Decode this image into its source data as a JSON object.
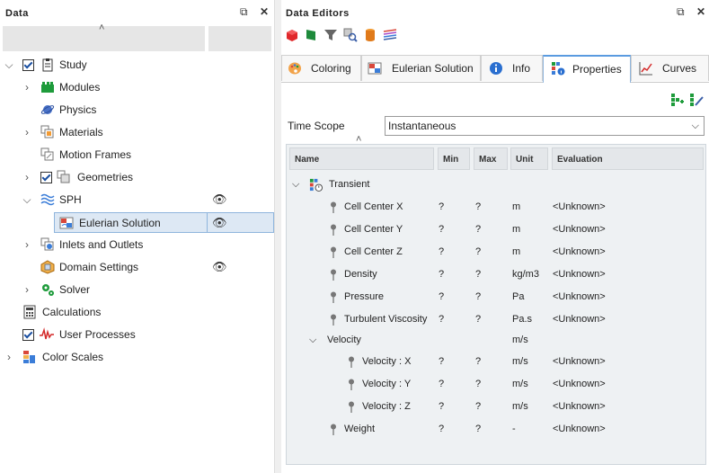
{
  "left_panel": {
    "title": "Data",
    "tree": [
      {
        "label": "Study"
      },
      {
        "label": "Modules"
      },
      {
        "label": "Physics"
      },
      {
        "label": "Materials"
      },
      {
        "label": "Motion Frames"
      },
      {
        "label": "Geometries"
      },
      {
        "label": "SPH"
      },
      {
        "label": "Eulerian Solution"
      },
      {
        "label": "Inlets and Outlets"
      },
      {
        "label": "Domain Settings"
      },
      {
        "label": "Solver"
      },
      {
        "label": "Calculations"
      },
      {
        "label": "User Processes"
      },
      {
        "label": "Color Scales"
      }
    ]
  },
  "right_panel": {
    "title": "Data Editors",
    "tabs": [
      {
        "label": "Coloring"
      },
      {
        "label": "Eulerian Solution"
      },
      {
        "label": "Info"
      },
      {
        "label": "Properties"
      },
      {
        "label": "Curves"
      }
    ],
    "time_scope": {
      "label": "Time Scope",
      "value": "Instantaneous"
    },
    "columns": [
      "Name",
      "Min",
      "Max",
      "Unit",
      "Evaluation"
    ],
    "group": "Transient",
    "rows": [
      {
        "name": "Cell Center X",
        "min": "?",
        "max": "?",
        "unit": "m",
        "evaluation": "<Unknown>"
      },
      {
        "name": "Cell Center Y",
        "min": "?",
        "max": "?",
        "unit": "m",
        "evaluation": "<Unknown>"
      },
      {
        "name": "Cell Center Z",
        "min": "?",
        "max": "?",
        "unit": "m",
        "evaluation": "<Unknown>"
      },
      {
        "name": "Density",
        "min": "?",
        "max": "?",
        "unit": "kg/m3",
        "evaluation": "<Unknown>"
      },
      {
        "name": "Pressure",
        "min": "?",
        "max": "?",
        "unit": "Pa",
        "evaluation": "<Unknown>"
      },
      {
        "name": "Turbulent Viscosity",
        "min": "?",
        "max": "?",
        "unit": "Pa.s",
        "evaluation": "<Unknown>"
      }
    ],
    "velocity_group": {
      "name": "Velocity",
      "unit": "m/s"
    },
    "velocity_rows": [
      {
        "name": "Velocity : X",
        "min": "?",
        "max": "?",
        "unit": "m/s",
        "evaluation": "<Unknown>"
      },
      {
        "name": "Velocity : Y",
        "min": "?",
        "max": "?",
        "unit": "m/s",
        "evaluation": "<Unknown>"
      },
      {
        "name": "Velocity : Z",
        "min": "?",
        "max": "?",
        "unit": "m/s",
        "evaluation": "<Unknown>"
      }
    ],
    "weight_row": {
      "name": "Weight",
      "min": "?",
      "max": "?",
      "unit": "-",
      "evaluation": "<Unknown>"
    }
  },
  "colors": {
    "accent": "#5a9be0",
    "selection_bg": "#dde8f4",
    "selection_border": "#8fb5dd"
  }
}
